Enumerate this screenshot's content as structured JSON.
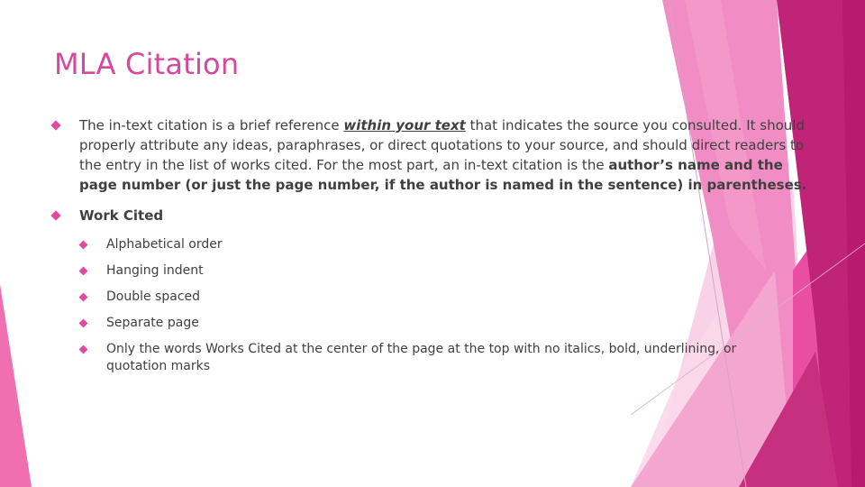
{
  "slide": {
    "title": "MLA Citation",
    "colors": {
      "title": "#d6489c",
      "bullet": "#e04aa0",
      "body_text": "#404040",
      "accent_dark": "#c01f78",
      "accent_mid": "#e84fa3",
      "accent_light": "#f28cc4",
      "accent_pale": "#f7c8e2"
    },
    "bullets": [
      {
        "icon": "diamond-bullet-icon",
        "segments": {
          "s1": "The in-text citation is a brief reference ",
          "s2_emph": "within your text",
          "s3": " that indicates the source you consulted. It should properly attribute any ideas, paraphrases, or direct quotations to your source, and should direct readers to the entry in the list of works cited. For the most part, an in-text citation is the ",
          "s4_bold": "author’s name and the page number (or just the page number, if the author is named in the sentence) in parentheses."
        }
      },
      {
        "icon": "diamond-bullet-icon",
        "label": "Work Cited",
        "children": [
          {
            "label": "Alphabetical order"
          },
          {
            "label": "Hanging indent"
          },
          {
            "label": "Double spaced"
          },
          {
            "label": "Separate page"
          },
          {
            "label": "Only the words Works Cited at the center of the page at the top with no italics, bold, underlining, or quotation marks"
          }
        ]
      }
    ]
  }
}
